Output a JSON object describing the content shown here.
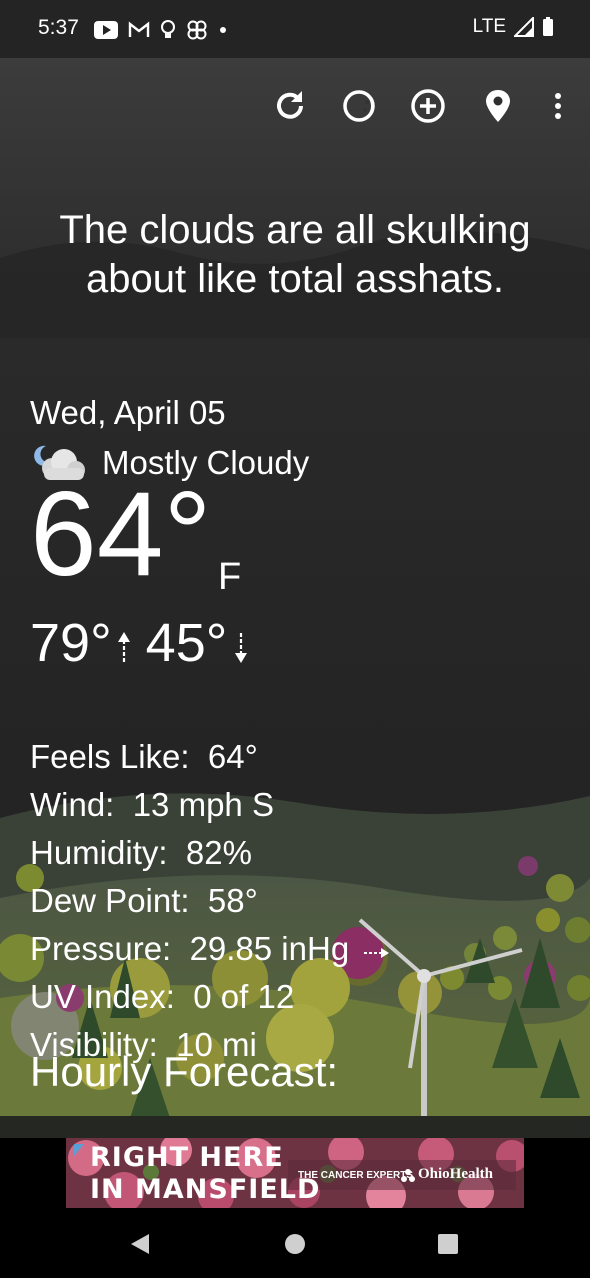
{
  "status_bar": {
    "time": "5:37",
    "network": "LTE"
  },
  "toolbar": {
    "icons": [
      "refresh-icon",
      "theme-icon",
      "add-location-icon",
      "location-pin-icon",
      "more-vert-icon"
    ]
  },
  "headline": {
    "line1": "The clouds are all skulking",
    "line2": "about like total asshats."
  },
  "current": {
    "date": "Wed, April 05",
    "condition": "Mostly Cloudy",
    "temperature": "64°",
    "unit": "F",
    "high": "79°",
    "low": "45°"
  },
  "details": [
    {
      "label": "Feels Like:",
      "value": "64°"
    },
    {
      "label": "Wind:",
      "value": "13 mph S"
    },
    {
      "label": "Humidity:",
      "value": "82%"
    },
    {
      "label": "Dew Point:",
      "value": "58°"
    },
    {
      "label": "Pressure:",
      "value": "29.85 inHg"
    },
    {
      "label": "UV Index:",
      "value": "0 of 12"
    },
    {
      "label": "Visibility:",
      "value": "10 mi"
    }
  ],
  "hourly": {
    "title": "Hourly Forecast:"
  },
  "ad": {
    "line1": "RIGHT HERE",
    "line2": "IN MANSFIELD",
    "tagline": "THE CANCER EXPERTS",
    "brand": "OhioHealth"
  }
}
